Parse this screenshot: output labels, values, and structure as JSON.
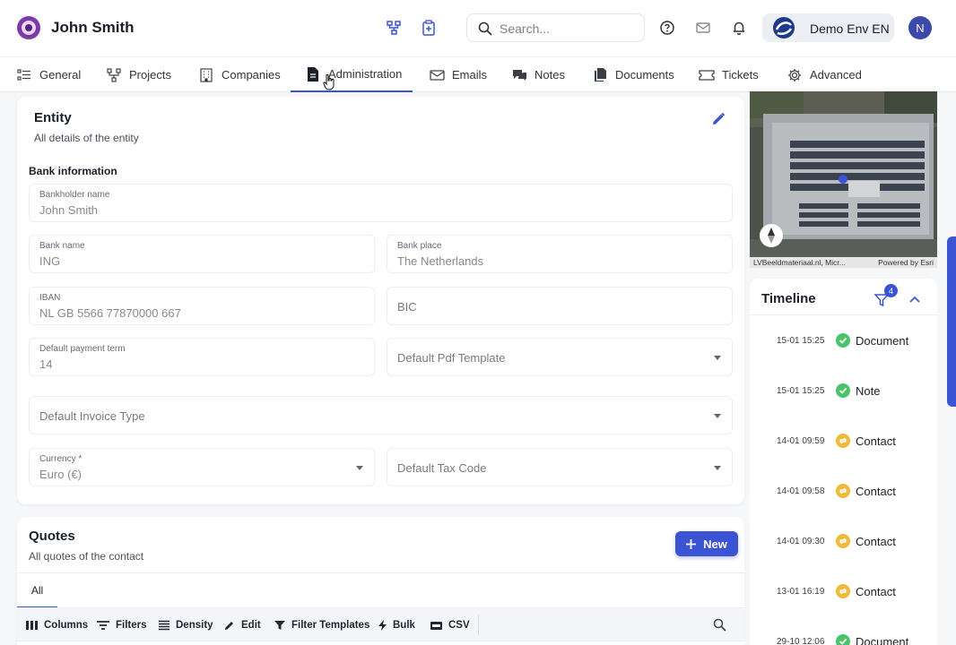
{
  "header": {
    "title": "John Smith",
    "search_placeholder": "Search...",
    "environment": "Demo Env EN",
    "avatar_initial": "N"
  },
  "tabs": [
    {
      "label": "General",
      "icon": "list-icon"
    },
    {
      "label": "Projects",
      "icon": "hierarchy-icon"
    },
    {
      "label": "Companies",
      "icon": "building-icon"
    },
    {
      "label": "Administration",
      "icon": "document-icon",
      "active": true
    },
    {
      "label": "Emails",
      "icon": "mail-icon"
    },
    {
      "label": "Notes",
      "icon": "chat-icon"
    },
    {
      "label": "Documents",
      "icon": "documents-icon"
    },
    {
      "label": "Tickets",
      "icon": "ticket-icon"
    },
    {
      "label": "Advanced",
      "icon": "gear-icon"
    }
  ],
  "entity": {
    "title": "Entity",
    "subtitle": "All details of the entity",
    "section": "Bank information",
    "fields": {
      "bankholder": {
        "label": "Bankholder name",
        "value": "John Smith"
      },
      "bank_name": {
        "label": "Bank name",
        "value": "ING"
      },
      "bank_place": {
        "label": "Bank place",
        "value": "The Netherlands"
      },
      "iban": {
        "label": "IBAN",
        "value": "NL GB 5566 77870000 667"
      },
      "bic": {
        "placeholder": "BIC"
      },
      "payment_term": {
        "label": "Default payment term",
        "value": "14"
      },
      "pdf_template": {
        "placeholder": "Default Pdf Template"
      },
      "invoice_type": {
        "placeholder": "Default Invoice Type"
      },
      "currency": {
        "label": "Currency *",
        "value": "Euro (€)"
      },
      "tax_code": {
        "placeholder": "Default Tax Code"
      }
    }
  },
  "quotes": {
    "title": "Quotes",
    "subtitle": "All quotes of the contact",
    "new_label": "New",
    "tab_all": "All",
    "toolbar": [
      "Columns",
      "Filters",
      "Density",
      "Edit",
      "Filter Templates",
      "Bulk",
      "CSV"
    ]
  },
  "map": {
    "attribution_left": "LVBeeldmateriaal.nl, Micr...",
    "attribution_right": "Powered by Esri"
  },
  "timeline": {
    "title": "Timeline",
    "filter_count": "4",
    "items": [
      {
        "time": "15-01 15:25",
        "label": "Document",
        "status": "done"
      },
      {
        "time": "15-01 15:25",
        "label": "Note",
        "status": "done"
      },
      {
        "time": "14-01 09:59",
        "label": "Contact",
        "status": "sync"
      },
      {
        "time": "14-01 09:58",
        "label": "Contact",
        "status": "sync"
      },
      {
        "time": "14-01 09:30",
        "label": "Contact",
        "status": "sync"
      },
      {
        "time": "13-01 16:19",
        "label": "Contact",
        "status": "sync"
      },
      {
        "time": "29-10 12:06",
        "label": "Document",
        "status": "done"
      }
    ]
  },
  "colors": {
    "accent": "#3b54d4",
    "done": "#4cc36b",
    "sync": "#f0b93a"
  }
}
